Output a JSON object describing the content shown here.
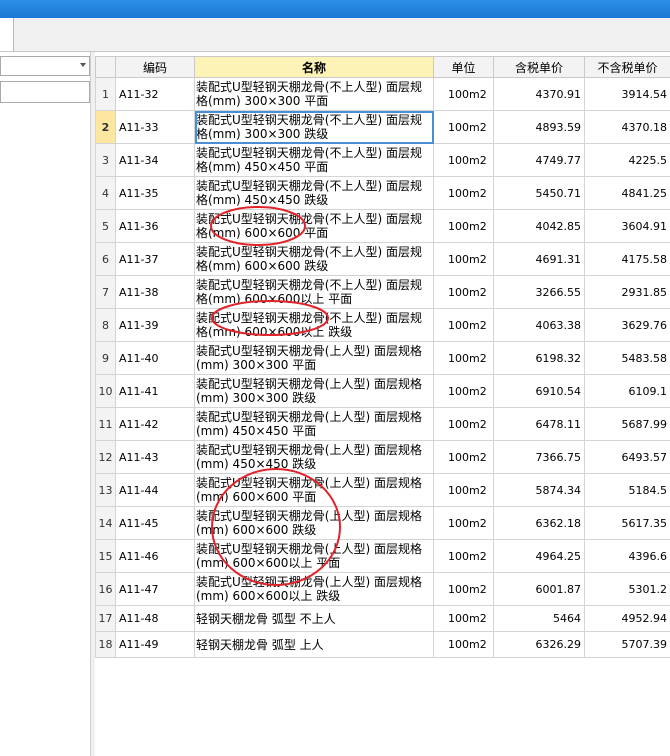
{
  "table": {
    "headers": [
      "",
      "编码",
      "名称",
      "单位",
      "含税单价",
      "不含税单价"
    ],
    "selected_row": 2,
    "rows": [
      {
        "idx": "1",
        "code": "A11-32",
        "name": "装配式U型轻钢天棚龙骨(不上人型) 面层规格(mm) 300×300 平面",
        "unit": "100m2",
        "tax_price": "4370.91",
        "notax_price": "3914.54"
      },
      {
        "idx": "2",
        "code": "A11-33",
        "name": "装配式U型轻钢天棚龙骨(不上人型) 面层规格(mm) 300×300 跌级",
        "unit": "100m2",
        "tax_price": "4893.59",
        "notax_price": "4370.18"
      },
      {
        "idx": "3",
        "code": "A11-34",
        "name": "装配式U型轻钢天棚龙骨(不上人型) 面层规格(mm) 450×450 平面",
        "unit": "100m2",
        "tax_price": "4749.77",
        "notax_price": "4225.5"
      },
      {
        "idx": "4",
        "code": "A11-35",
        "name": "装配式U型轻钢天棚龙骨(不上人型) 面层规格(mm) 450×450 跌级",
        "unit": "100m2",
        "tax_price": "5450.71",
        "notax_price": "4841.25"
      },
      {
        "idx": "5",
        "code": "A11-36",
        "name": "装配式U型轻钢天棚龙骨(不上人型) 面层规格(mm) 600×600 平面",
        "unit": "100m2",
        "tax_price": "4042.85",
        "notax_price": "3604.91"
      },
      {
        "idx": "6",
        "code": "A11-37",
        "name": "装配式U型轻钢天棚龙骨(不上人型) 面层规格(mm) 600×600 跌级",
        "unit": "100m2",
        "tax_price": "4691.31",
        "notax_price": "4175.58"
      },
      {
        "idx": "7",
        "code": "A11-38",
        "name": "装配式U型轻钢天棚龙骨(不上人型) 面层规格(mm) 600×600以上 平面",
        "unit": "100m2",
        "tax_price": "3266.55",
        "notax_price": "2931.85"
      },
      {
        "idx": "8",
        "code": "A11-39",
        "name": "装配式U型轻钢天棚龙骨(不上人型) 面层规格(mm) 600×600以上 跌级",
        "unit": "100m2",
        "tax_price": "4063.38",
        "notax_price": "3629.76"
      },
      {
        "idx": "9",
        "code": "A11-40",
        "name": "装配式U型轻钢天棚龙骨(上人型) 面层规格(mm) 300×300 平面",
        "unit": "100m2",
        "tax_price": "6198.32",
        "notax_price": "5483.58"
      },
      {
        "idx": "10",
        "code": "A11-41",
        "name": "装配式U型轻钢天棚龙骨(上人型) 面层规格(mm) 300×300 跌级",
        "unit": "100m2",
        "tax_price": "6910.54",
        "notax_price": "6109.1"
      },
      {
        "idx": "11",
        "code": "A11-42",
        "name": "装配式U型轻钢天棚龙骨(上人型) 面层规格(mm) 450×450 平面",
        "unit": "100m2",
        "tax_price": "6478.11",
        "notax_price": "5687.99"
      },
      {
        "idx": "12",
        "code": "A11-43",
        "name": "装配式U型轻钢天棚龙骨(上人型) 面层规格(mm) 450×450 跌级",
        "unit": "100m2",
        "tax_price": "7366.75",
        "notax_price": "6493.57"
      },
      {
        "idx": "13",
        "code": "A11-44",
        "name": "装配式U型轻钢天棚龙骨(上人型) 面层规格(mm) 600×600 平面",
        "unit": "100m2",
        "tax_price": "5874.34",
        "notax_price": "5184.5"
      },
      {
        "idx": "14",
        "code": "A11-45",
        "name": "装配式U型轻钢天棚龙骨(上人型) 面层规格(mm) 600×600 跌级",
        "unit": "100m2",
        "tax_price": "6362.18",
        "notax_price": "5617.35"
      },
      {
        "idx": "15",
        "code": "A11-46",
        "name": "装配式U型轻钢天棚龙骨(上人型) 面层规格(mm) 600×600以上 平面",
        "unit": "100m2",
        "tax_price": "4964.25",
        "notax_price": "4396.6"
      },
      {
        "idx": "16",
        "code": "A11-47",
        "name": "装配式U型轻钢天棚龙骨(上人型) 面层规格(mm) 600×600以上 跌级",
        "unit": "100m2",
        "tax_price": "6001.87",
        "notax_price": "5301.2"
      },
      {
        "idx": "17",
        "code": "A11-48",
        "name": "轻钢天棚龙骨 弧型 不上人",
        "unit": "100m2",
        "tax_price": "5464",
        "notax_price": "4952.94"
      },
      {
        "idx": "18",
        "code": "A11-49",
        "name": "轻钢天棚龙骨 弧型 上人",
        "unit": "100m2",
        "tax_price": "6326.29",
        "notax_price": "5707.39"
      }
    ]
  },
  "colors": {
    "titlebar": "#1b78d6",
    "header_highlight": "#fdf3b6",
    "selected_index": "#fde7a0",
    "annotation": "#e0242a"
  }
}
